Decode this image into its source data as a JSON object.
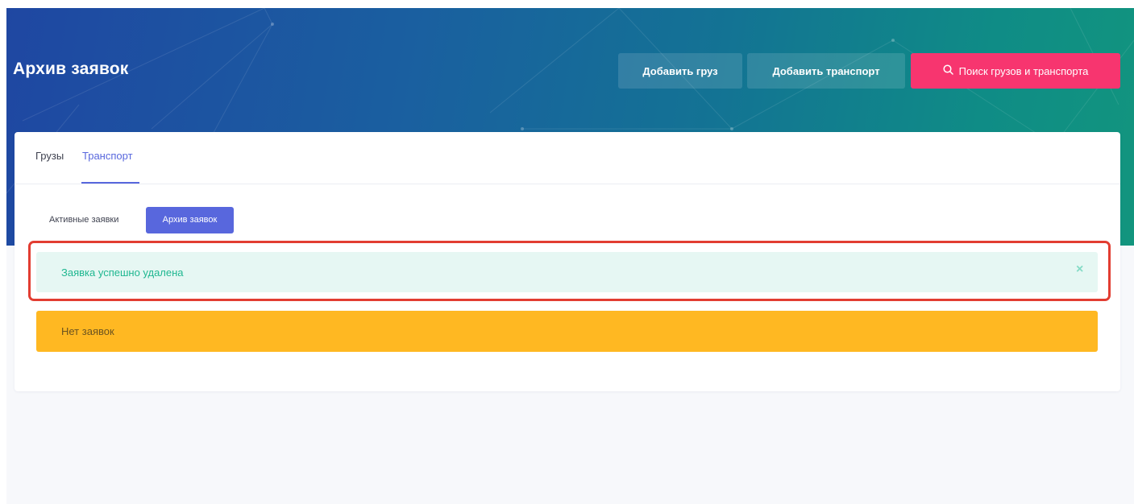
{
  "header": {
    "title": "Архив заявок",
    "buttons": {
      "add_cargo": "Добавить груз",
      "add_transport": "Добавить транспорт",
      "search": "Поиск грузов и транспорта"
    },
    "search_icon": "search-icon",
    "colors": {
      "search_button": "#f7356f",
      "gradient_start": "#1f47a2",
      "gradient_end": "#12957e"
    }
  },
  "tabs": {
    "cargo": "Грузы",
    "transport": "Транспорт",
    "active": "transport"
  },
  "subnav": {
    "active_requests": "Активные заявки",
    "archive": "Архив заявок",
    "selected": "archive"
  },
  "alerts": {
    "success": {
      "message": "Заявка успешно удалена",
      "close_symbol": "×",
      "color": "#1fb790"
    },
    "warning": {
      "message": "Нет заявок",
      "color": "#ffb822"
    }
  },
  "accent_color": "#5867dd"
}
